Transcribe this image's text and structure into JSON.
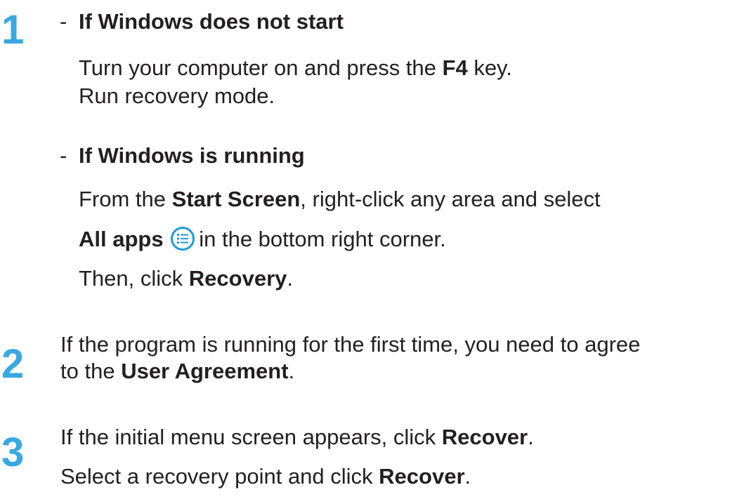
{
  "steps": [
    {
      "number": "1"
    },
    {
      "number": "2"
    },
    {
      "number": "3"
    }
  ],
  "step1": {
    "case_a": {
      "dash": "-",
      "heading": "If Windows does not start",
      "line1": {
        "pre": "Turn your computer on and press the ",
        "bold": "F4",
        "post": " key."
      },
      "line2": "Run recovery mode."
    },
    "case_b": {
      "dash": "-",
      "heading": "If Windows is running",
      "line1": {
        "pre": "From the ",
        "bold": "Start Screen",
        "post": ", right-click any area and select"
      },
      "line2": {
        "bold": "All apps",
        "post": "in the bottom right corner."
      },
      "line3": {
        "pre": "Then, click ",
        "bold": "Recovery",
        "post": "."
      },
      "icon": "all-apps-icon"
    }
  },
  "step2": {
    "line1": "If the program is running for the first time, you need to agree",
    "line2": {
      "pre": "to the ",
      "bold": "User Agreement",
      "post": "."
    }
  },
  "step3": {
    "line1": {
      "pre": "If the initial menu screen appears, click ",
      "bold": "Recover",
      "post": "."
    },
    "line2": {
      "pre": "Select a recovery point and click ",
      "bold": "Recover",
      "post": "."
    }
  },
  "colors": {
    "step_number": "#3aa8e0",
    "icon": "#1e9ad6",
    "text": "#231f20"
  }
}
